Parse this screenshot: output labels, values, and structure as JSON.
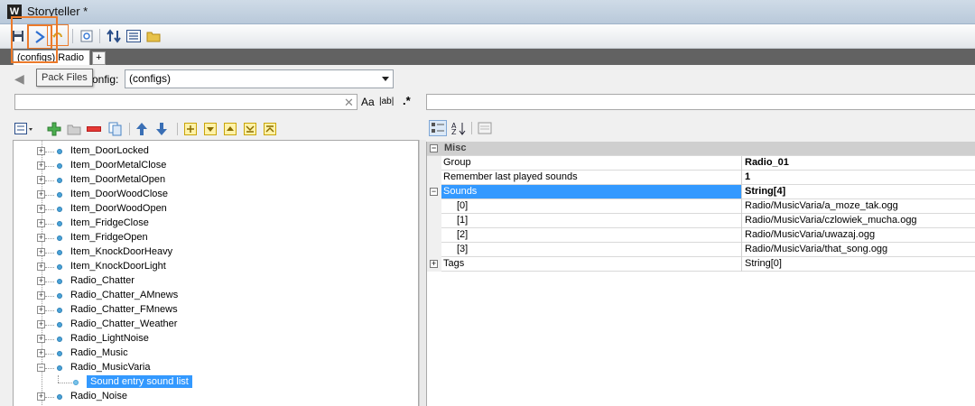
{
  "window": {
    "title": "Storyteller *",
    "app_icon_text": "W"
  },
  "toolbar": {
    "icons": [
      "save-icon",
      "pack-files-icon",
      "undo-icon",
      "preview-icon",
      "sort-icon",
      "list-icon",
      "folder-icon"
    ],
    "tooltip": "Pack Files"
  },
  "tabs": {
    "active_label": "(configs) Radio",
    "add_label": "+"
  },
  "config_bar": {
    "back": "◀",
    "label": "onfig:",
    "selected": "(configs)"
  },
  "search": {
    "clear": "✕",
    "match_case": "Aa",
    "whole_word": "|ab|",
    "regex": ".*"
  },
  "tree": {
    "items": [
      "Item_DoorLocked",
      "Item_DoorMetalClose",
      "Item_DoorMetalOpen",
      "Item_DoorWoodClose",
      "Item_DoorWoodOpen",
      "Item_FridgeClose",
      "Item_FridgeOpen",
      "Item_KnockDoorHeavy",
      "Item_KnockDoorLight",
      "Radio_Chatter",
      "Radio_Chatter_AMnews",
      "Radio_Chatter_FMnews",
      "Radio_Chatter_Weather",
      "Radio_LightNoise",
      "Radio_Music",
      "Radio_MusicVaria",
      "Radio_Noise"
    ],
    "expanded_index": 15,
    "child_label": "Sound entry sound list"
  },
  "properties": {
    "category": "Misc",
    "rows": [
      {
        "name": "Group",
        "value": "Radio_01",
        "bold": true
      },
      {
        "name": "Remember last played sounds",
        "value": "1",
        "bold": true
      },
      {
        "name": "Sounds",
        "value": "String[4]",
        "bold": true
      },
      {
        "name": "[0]",
        "value": "Radio/MusicVaria/a_moze_tak.ogg"
      },
      {
        "name": "[1]",
        "value": "Radio/MusicVaria/czlowiek_mucha.ogg"
      },
      {
        "name": "[2]",
        "value": "Radio/MusicVaria/uwazaj.ogg"
      },
      {
        "name": "[3]",
        "value": "Radio/MusicVaria/that_song.ogg"
      },
      {
        "name": "Tags",
        "value": "String[0]"
      }
    ],
    "expander_collapse": "−",
    "expander_expand": "+"
  },
  "colors": {
    "selection": "#3399ff",
    "highlight_box": "#ec7a2a",
    "tab_strip": "#626262"
  }
}
